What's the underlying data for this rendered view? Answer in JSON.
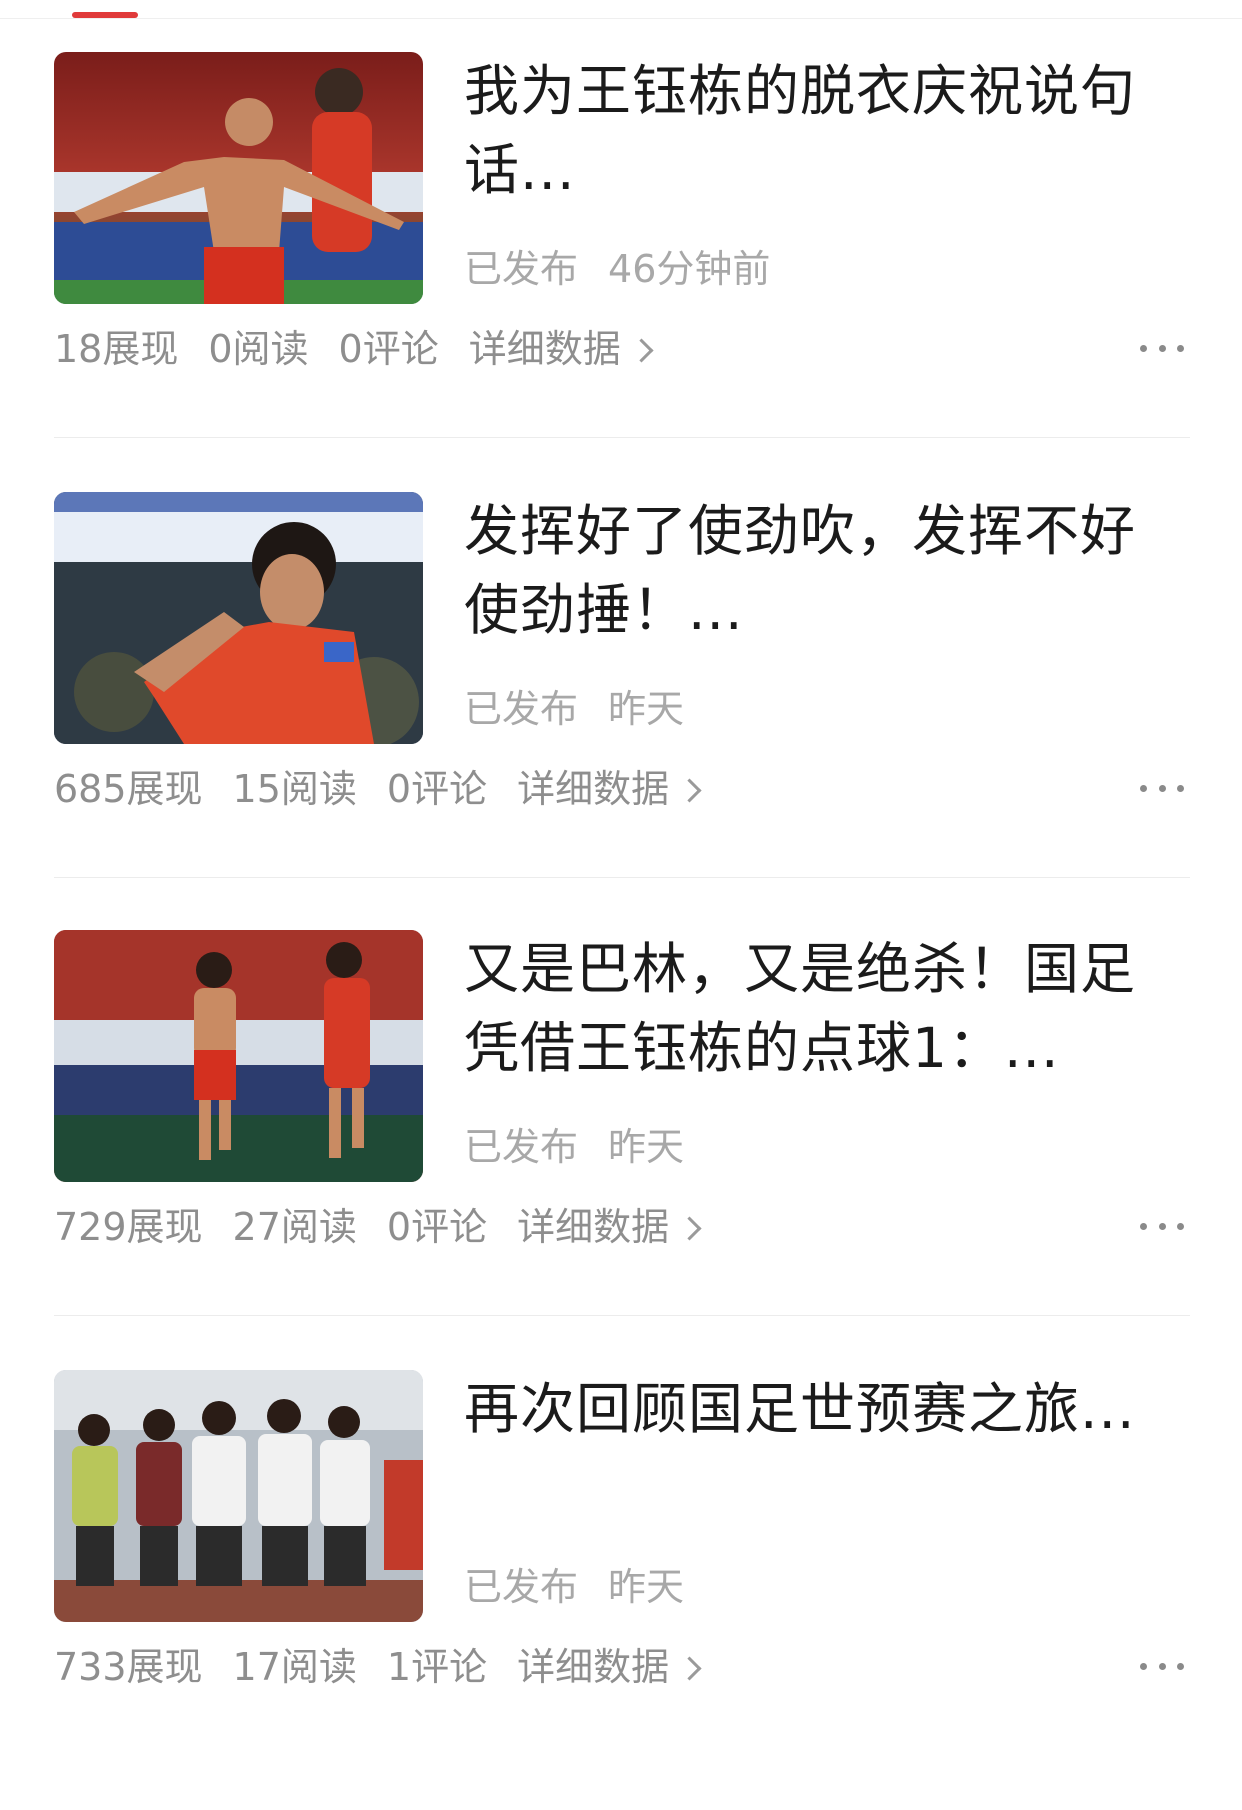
{
  "theme": {
    "accent": "#e03a3a"
  },
  "articles": [
    {
      "thumbnail": "celebrating-player-photo",
      "title": "我为王钰栋的脱衣庆祝说句话...",
      "status": "已发布",
      "time": "46分钟前",
      "impressions": "18展现",
      "reads": "0阅读",
      "comments": "0评论",
      "detail": "详细数据"
    },
    {
      "thumbnail": "player-gesture-photo",
      "title": "发挥好了使劲吹，发挥不好使劲捶！...",
      "status": "已发布",
      "time": "昨天",
      "impressions": "685展现",
      "reads": "15阅读",
      "comments": "0评论",
      "detail": "详细数据"
    },
    {
      "thumbnail": "players-running-photo",
      "title": "又是巴林，又是绝杀！国足凭借王钰栋的点球1：...",
      "status": "已发布",
      "time": "昨天",
      "impressions": "729展现",
      "reads": "27阅读",
      "comments": "0评论",
      "detail": "详细数据"
    },
    {
      "thumbnail": "team-applauding-photo",
      "title": "再次回顾国足世预赛之旅...",
      "status": "已发布",
      "time": "昨天",
      "impressions": "733展现",
      "reads": "17阅读",
      "comments": "1评论",
      "detail": "详细数据"
    }
  ]
}
